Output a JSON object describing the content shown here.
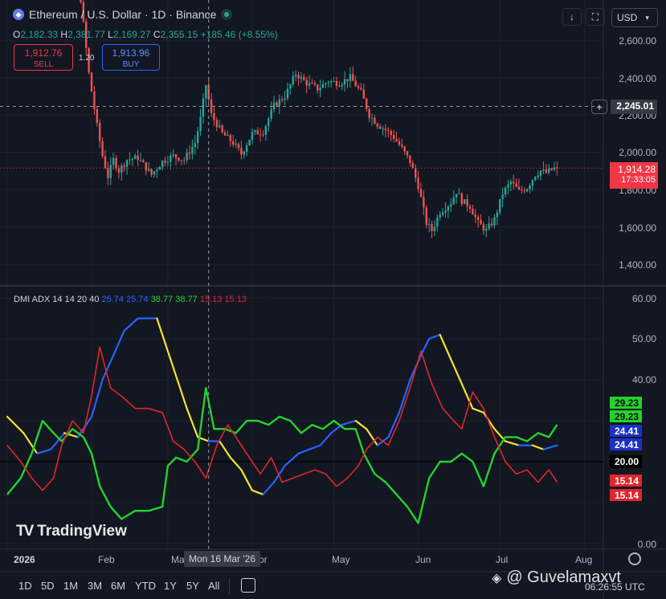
{
  "header": {
    "title": "Ethereum / U.S. Dollar · 1D · Binance",
    "ohlc": [
      {
        "k": "O",
        "v": "2,182.33"
      },
      {
        "k": "H",
        "v": "2,381.77"
      },
      {
        "k": "L",
        "v": "2,169.27"
      },
      {
        "k": "C",
        "v": "2,355.15"
      }
    ],
    "change": "+185.46 (+8.55%)"
  },
  "trade": {
    "sell_price": "1,912.76",
    "sell_label": "SELL",
    "spread": "1.20",
    "buy_price": "1,913.96",
    "buy_label": "BUY"
  },
  "toolbar": {
    "currency": "USD",
    "down_icon": "arrow-down-icon",
    "fullscreen_icon": "fullscreen-icon"
  },
  "price_axis": {
    "labels": [
      "2,600.00",
      "2,400.00",
      "2,200.00",
      "2,000.00",
      "1,800.00",
      "1,600.00",
      "1,400.00"
    ],
    "crosshair_price": "2,245.01",
    "last_price": "1,914.28",
    "countdown": "17:33:05"
  },
  "indicator": {
    "name": "DMI ADX 14 14 20 40",
    "values": [
      {
        "v": "25.74",
        "c": "#2962ff"
      },
      {
        "v": "25.74",
        "c": "#2962ff"
      },
      {
        "v": "38.77",
        "c": "#22d32b"
      },
      {
        "v": "38.77",
        "c": "#22d32b"
      },
      {
        "v": "15.13",
        "c": "#e0262b"
      },
      {
        "v": "15.13",
        "c": "#e0262b"
      },
      {
        "v": "20.00",
        "c": "#1b1b1b"
      }
    ],
    "axis_labels": [
      "60.00",
      "50.00",
      "40.00",
      "30.00",
      "20.00",
      "10.00",
      "0.00"
    ],
    "tags": {
      "green_a": "29.23",
      "green_b": "29.23",
      "blue_a": "24.41",
      "blue_b": "24.41",
      "level": "20.00",
      "red_a": "15.14",
      "red_b": "15.14"
    }
  },
  "time_axis": {
    "labels": [
      "2026",
      "Feb",
      "Mar",
      "Apr",
      "May",
      "Jun",
      "Jul",
      "Aug"
    ],
    "crosshair_date": "Mon 16 Mar '26"
  },
  "ranges": [
    "1D",
    "5D",
    "1M",
    "3M",
    "6M",
    "YTD",
    "1Y",
    "5Y",
    "All"
  ],
  "footer": {
    "time": "06:26:55 UTC",
    "brand": "TradingView",
    "watermark": "@ Guvelamaxvt"
  },
  "colors": {
    "up": "#26a69a",
    "down": "#ef5350",
    "adx": "#2962ff",
    "adx_falling": "#f5e22f",
    "di_plus": "#22d32b",
    "di_minus": "#e0262b",
    "background": "#131722"
  },
  "chart_data": [
    {
      "type": "candlestick",
      "title": "Ethereum / U.S. Dollar · 1D · Binance",
      "x_range": [
        "2026-01-01",
        "2026-08-08"
      ],
      "ylim": [
        1300,
        2700
      ],
      "grid": true,
      "crosshair": {
        "x": "2026-03-16",
        "y": 2245.01
      },
      "last_price": 1914.28,
      "anchors": [
        {
          "x": "2026-01-14",
          "y": 3300
        },
        {
          "x": "2026-01-20",
          "y": 3280
        },
        {
          "x": "2026-01-27",
          "y": 2980
        },
        {
          "x": "2026-01-29",
          "y": 2820
        },
        {
          "x": "2026-02-01",
          "y": 2420
        },
        {
          "x": "2026-02-04",
          "y": 2140
        },
        {
          "x": "2026-02-06",
          "y": 1980
        },
        {
          "x": "2026-02-08",
          "y": 1870
        },
        {
          "x": "2026-02-10",
          "y": 1960
        },
        {
          "x": "2026-02-12",
          "y": 1900
        },
        {
          "x": "2026-02-15",
          "y": 1960
        },
        {
          "x": "2026-02-19",
          "y": 1970
        },
        {
          "x": "2026-02-24",
          "y": 1880
        },
        {
          "x": "2026-02-28",
          "y": 1950
        },
        {
          "x": "2026-03-04",
          "y": 1980
        },
        {
          "x": "2026-03-08",
          "y": 1960
        },
        {
          "x": "2026-03-12",
          "y": 2050
        },
        {
          "x": "2026-03-14",
          "y": 2180
        },
        {
          "x": "2026-03-16",
          "y": 2360
        },
        {
          "x": "2026-03-18",
          "y": 2200
        },
        {
          "x": "2026-03-22",
          "y": 2100
        },
        {
          "x": "2026-03-26",
          "y": 2050
        },
        {
          "x": "2026-03-29",
          "y": 1990
        },
        {
          "x": "2026-04-02",
          "y": 2100
        },
        {
          "x": "2026-04-06",
          "y": 2110
        },
        {
          "x": "2026-04-10",
          "y": 2250
        },
        {
          "x": "2026-04-14",
          "y": 2300
        },
        {
          "x": "2026-04-18",
          "y": 2420
        },
        {
          "x": "2026-04-22",
          "y": 2370
        },
        {
          "x": "2026-04-26",
          "y": 2340
        },
        {
          "x": "2026-04-30",
          "y": 2380
        },
        {
          "x": "2026-05-04",
          "y": 2370
        },
        {
          "x": "2026-05-08",
          "y": 2400
        },
        {
          "x": "2026-05-12",
          "y": 2320
        },
        {
          "x": "2026-05-15",
          "y": 2200
        },
        {
          "x": "2026-05-18",
          "y": 2150
        },
        {
          "x": "2026-05-21",
          "y": 2120
        },
        {
          "x": "2026-05-24",
          "y": 2080
        },
        {
          "x": "2026-05-27",
          "y": 2020
        },
        {
          "x": "2026-05-30",
          "y": 1950
        },
        {
          "x": "2026-06-02",
          "y": 1820
        },
        {
          "x": "2026-06-05",
          "y": 1620
        },
        {
          "x": "2026-06-07",
          "y": 1580
        },
        {
          "x": "2026-06-10",
          "y": 1680
        },
        {
          "x": "2026-06-14",
          "y": 1730
        },
        {
          "x": "2026-06-16",
          "y": 1790
        },
        {
          "x": "2026-06-18",
          "y": 1740
        },
        {
          "x": "2026-06-21",
          "y": 1710
        },
        {
          "x": "2026-06-24",
          "y": 1620
        },
        {
          "x": "2026-06-27",
          "y": 1580
        },
        {
          "x": "2026-06-30",
          "y": 1640
        },
        {
          "x": "2026-07-03",
          "y": 1780
        },
        {
          "x": "2026-07-06",
          "y": 1840
        },
        {
          "x": "2026-07-09",
          "y": 1790
        },
        {
          "x": "2026-07-12",
          "y": 1810
        },
        {
          "x": "2026-07-15",
          "y": 1880
        },
        {
          "x": "2026-07-17",
          "y": 1900
        },
        {
          "x": "2026-07-19",
          "y": 1890
        },
        {
          "x": "2026-07-22",
          "y": 1914
        }
      ]
    },
    {
      "type": "line",
      "title": "DMI ADX 14 14 20 40",
      "ylim": [
        0,
        60
      ],
      "level": 20,
      "x_range": [
        "2026-01-01",
        "2026-08-08"
      ],
      "series": [
        {
          "name": "ADX",
          "color": "#2962ff",
          "points": [
            [
              "2026-01-01",
              31
            ],
            [
              "2026-01-07",
              27
            ],
            [
              "2026-01-12",
              22
            ],
            [
              "2026-01-17",
              23
            ],
            [
              "2026-01-22",
              27
            ],
            [
              "2026-01-27",
              26
            ],
            [
              "2026-02-01",
              31
            ],
            [
              "2026-02-05",
              40
            ],
            [
              "2026-02-09",
              46
            ],
            [
              "2026-02-13",
              52
            ],
            [
              "2026-02-18",
              55
            ],
            [
              "2026-02-23",
              55
            ],
            [
              "2026-02-25",
              55
            ],
            [
              "2026-02-28",
              49
            ],
            [
              "2026-03-04",
              41
            ],
            [
              "2026-03-08",
              33
            ],
            [
              "2026-03-12",
              26
            ],
            [
              "2026-03-16",
              25
            ],
            [
              "2026-03-20",
              25
            ],
            [
              "2026-03-24",
              21
            ],
            [
              "2026-03-28",
              18
            ],
            [
              "2026-04-01",
              13
            ],
            [
              "2026-04-05",
              12
            ],
            [
              "2026-04-09",
              15
            ],
            [
              "2026-04-13",
              19
            ],
            [
              "2026-04-18",
              22
            ],
            [
              "2026-04-22",
              23
            ],
            [
              "2026-04-26",
              24
            ],
            [
              "2026-04-30",
              27
            ],
            [
              "2026-05-04",
              29
            ],
            [
              "2026-05-09",
              30
            ],
            [
              "2026-05-13",
              28
            ],
            [
              "2026-05-17",
              24
            ],
            [
              "2026-05-21",
              26
            ],
            [
              "2026-05-25",
              32
            ],
            [
              "2026-05-29",
              40
            ],
            [
              "2026-06-02",
              46
            ],
            [
              "2026-06-05",
              50
            ],
            [
              "2026-06-09",
              51
            ],
            [
              "2026-06-13",
              45
            ],
            [
              "2026-06-17",
              39
            ],
            [
              "2026-06-21",
              33
            ],
            [
              "2026-06-25",
              32
            ],
            [
              "2026-06-29",
              28
            ],
            [
              "2026-07-03",
              25
            ],
            [
              "2026-07-08",
              24
            ],
            [
              "2026-07-13",
              24
            ],
            [
              "2026-07-17",
              23
            ],
            [
              "2026-07-22",
              24
            ]
          ]
        },
        {
          "name": "+DI",
          "color": "#22d32b",
          "points": [
            [
              "2026-01-01",
              12
            ],
            [
              "2026-01-06",
              16
            ],
            [
              "2026-01-10",
              22
            ],
            [
              "2026-01-14",
              30
            ],
            [
              "2026-01-18",
              27
            ],
            [
              "2026-01-21",
              25
            ],
            [
              "2026-01-25",
              28
            ],
            [
              "2026-01-29",
              26
            ],
            [
              "2026-02-01",
              22
            ],
            [
              "2026-02-04",
              14
            ],
            [
              "2026-02-08",
              9
            ],
            [
              "2026-02-12",
              6
            ],
            [
              "2026-02-17",
              8
            ],
            [
              "2026-02-22",
              8
            ],
            [
              "2026-02-27",
              9
            ],
            [
              "2026-03-01",
              19
            ],
            [
              "2026-03-04",
              21
            ],
            [
              "2026-03-08",
              20
            ],
            [
              "2026-03-12",
              23
            ],
            [
              "2026-03-15",
              38
            ],
            [
              "2026-03-18",
              28
            ],
            [
              "2026-03-22",
              28
            ],
            [
              "2026-03-26",
              27
            ],
            [
              "2026-03-30",
              30
            ],
            [
              "2026-04-03",
              30
            ],
            [
              "2026-04-07",
              29
            ],
            [
              "2026-04-11",
              31
            ],
            [
              "2026-04-15",
              30
            ],
            [
              "2026-04-19",
              27
            ],
            [
              "2026-04-23",
              29
            ],
            [
              "2026-04-27",
              28
            ],
            [
              "2026-05-01",
              30
            ],
            [
              "2026-05-05",
              28
            ],
            [
              "2026-05-09",
              28
            ],
            [
              "2026-05-12",
              22
            ],
            [
              "2026-05-16",
              17
            ],
            [
              "2026-05-20",
              15
            ],
            [
              "2026-05-24",
              12
            ],
            [
              "2026-05-28",
              9
            ],
            [
              "2026-06-01",
              5
            ],
            [
              "2026-06-05",
              16
            ],
            [
              "2026-06-09",
              20
            ],
            [
              "2026-06-13",
              20
            ],
            [
              "2026-06-17",
              22
            ],
            [
              "2026-06-21",
              20
            ],
            [
              "2026-06-25",
              14
            ],
            [
              "2026-06-29",
              22
            ],
            [
              "2026-07-03",
              26
            ],
            [
              "2026-07-07",
              26
            ],
            [
              "2026-07-11",
              25
            ],
            [
              "2026-07-15",
              27
            ],
            [
              "2026-07-19",
              26
            ],
            [
              "2026-07-22",
              29
            ]
          ]
        },
        {
          "name": "-DI",
          "color": "#e0262b",
          "points": [
            [
              "2026-01-01",
              24
            ],
            [
              "2026-01-06",
              20
            ],
            [
              "2026-01-10",
              16
            ],
            [
              "2026-01-14",
              13
            ],
            [
              "2026-01-18",
              16
            ],
            [
              "2026-01-21",
              24
            ],
            [
              "2026-01-25",
              30
            ],
            [
              "2026-01-29",
              27
            ],
            [
              "2026-02-01",
              36
            ],
            [
              "2026-02-04",
              48
            ],
            [
              "2026-02-08",
              38
            ],
            [
              "2026-02-12",
              36
            ],
            [
              "2026-02-17",
              33
            ],
            [
              "2026-02-22",
              33
            ],
            [
              "2026-02-27",
              32
            ],
            [
              "2026-03-03",
              25
            ],
            [
              "2026-03-07",
              23
            ],
            [
              "2026-03-11",
              20
            ],
            [
              "2026-03-15",
              16
            ],
            [
              "2026-03-19",
              24
            ],
            [
              "2026-03-23",
              29
            ],
            [
              "2026-03-27",
              25
            ],
            [
              "2026-03-31",
              21
            ],
            [
              "2026-04-04",
              17
            ],
            [
              "2026-04-08",
              21
            ],
            [
              "2026-04-12",
              15
            ],
            [
              "2026-04-16",
              16
            ],
            [
              "2026-04-20",
              17
            ],
            [
              "2026-04-24",
              18
            ],
            [
              "2026-04-28",
              17
            ],
            [
              "2026-05-02",
              14
            ],
            [
              "2026-05-06",
              16
            ],
            [
              "2026-05-10",
              19
            ],
            [
              "2026-05-13",
              23
            ],
            [
              "2026-05-17",
              26
            ],
            [
              "2026-05-21",
              24
            ],
            [
              "2026-05-25",
              30
            ],
            [
              "2026-05-29",
              38
            ],
            [
              "2026-06-02",
              47
            ],
            [
              "2026-06-06",
              39
            ],
            [
              "2026-06-10",
              33
            ],
            [
              "2026-06-14",
              30
            ],
            [
              "2026-06-17",
              28
            ],
            [
              "2026-06-21",
              37
            ],
            [
              "2026-06-25",
              33
            ],
            [
              "2026-06-29",
              26
            ],
            [
              "2026-07-03",
              20
            ],
            [
              "2026-07-07",
              17
            ],
            [
              "2026-07-11",
              18
            ],
            [
              "2026-07-15",
              15
            ],
            [
              "2026-07-19",
              18
            ],
            [
              "2026-07-22",
              15
            ]
          ]
        }
      ]
    }
  ]
}
